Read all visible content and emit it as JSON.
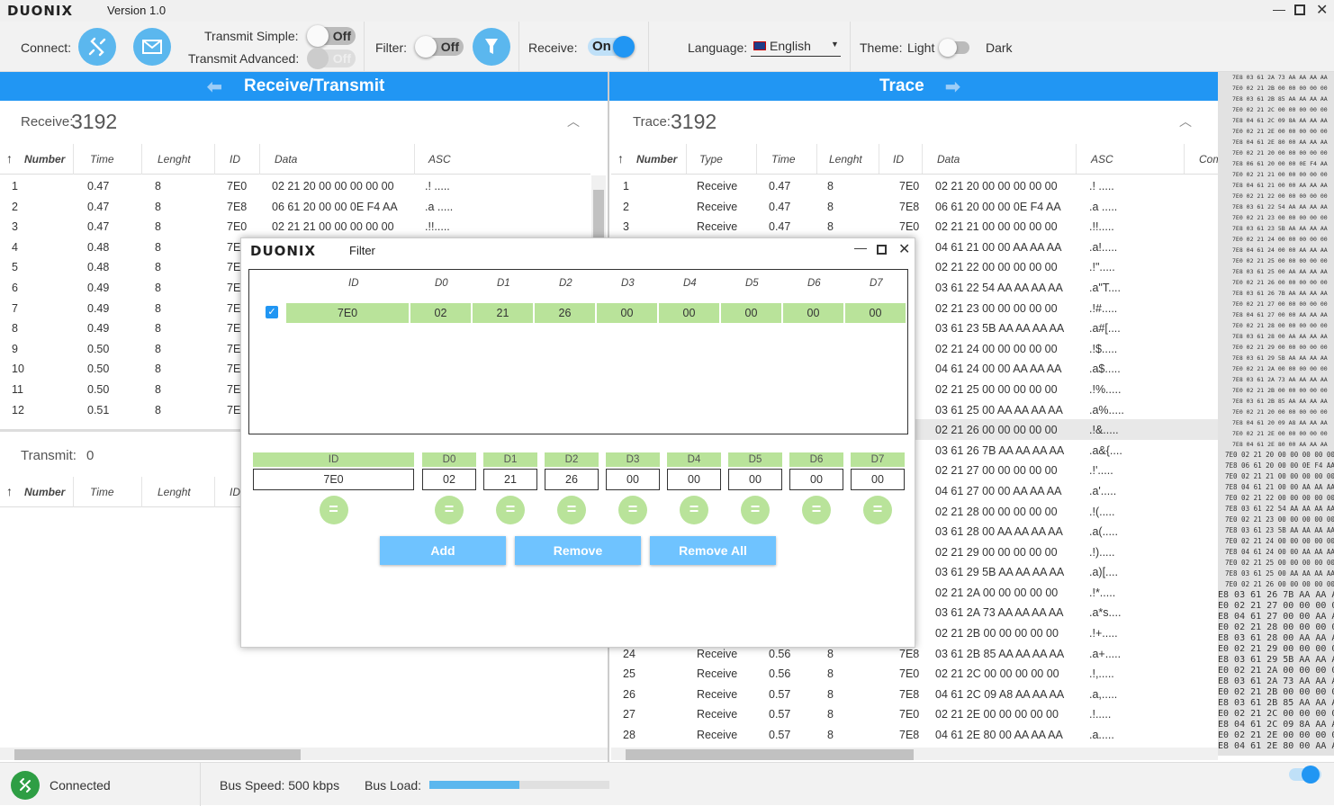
{
  "app": {
    "brand": "DUONIX",
    "version": "Version 1.0"
  },
  "toolbar": {
    "connect_label": "Connect:",
    "transmit_simple_label": "Transmit Simple:",
    "transmit_simple_state": "Off",
    "transmit_advanced_label": "Transmit Advanced:",
    "transmit_advanced_state": "Off",
    "filter_label": "Filter:",
    "filter_state": "Off",
    "receive_label": "Receive:",
    "receive_state": "On",
    "language_label": "Language:",
    "language_value": "English",
    "theme_label": "Theme:",
    "theme_light": "Light",
    "theme_dark": "Dark"
  },
  "left": {
    "title": "Receive/Transmit",
    "receive_label": "Receive:",
    "receive_count": "3192",
    "transmit_label": "Transmit:",
    "transmit_count": "0",
    "columns": [
      "Number",
      "Time",
      "Lenght",
      "ID",
      "Data",
      "ASC"
    ],
    "transmit_columns": [
      "Number",
      "Time",
      "Lenght",
      "ID"
    ],
    "rows": [
      [
        "1",
        "0.47",
        "8",
        "7E0",
        "02 21 20 00 00 00 00 00",
        ".! ....."
      ],
      [
        "2",
        "0.47",
        "8",
        "7E8",
        "06 61 20 00 00 0E F4 AA",
        ".a ....."
      ],
      [
        "3",
        "0.47",
        "8",
        "7E0",
        "02 21 21 00 00 00 00 00",
        ".!!....."
      ],
      [
        "4",
        "0.48",
        "8",
        "7E",
        "",
        ""
      ],
      [
        "5",
        "0.48",
        "8",
        "7E",
        "",
        ""
      ],
      [
        "6",
        "0.49",
        "8",
        "7E",
        "",
        ""
      ],
      [
        "7",
        "0.49",
        "8",
        "7E",
        "",
        ""
      ],
      [
        "8",
        "0.49",
        "8",
        "7E",
        "",
        ""
      ],
      [
        "9",
        "0.50",
        "8",
        "7E",
        "",
        ""
      ],
      [
        "10",
        "0.50",
        "8",
        "7E",
        "",
        ""
      ],
      [
        "11",
        "0.50",
        "8",
        "7E",
        "",
        ""
      ],
      [
        "12",
        "0.51",
        "8",
        "7E",
        "",
        ""
      ]
    ]
  },
  "right": {
    "title": "Trace",
    "trace_label": "Trace:",
    "trace_count": "3192",
    "columns": [
      "Number",
      "Type",
      "Time",
      "Lenght",
      "ID",
      "Data",
      "ASC",
      "Com"
    ],
    "rows": [
      [
        "1",
        "Receive",
        "0.47",
        "8",
        "7E0",
        "02 21 20 00 00 00 00 00",
        ".! ....."
      ],
      [
        "2",
        "Receive",
        "0.47",
        "8",
        "7E8",
        "06 61 20 00 00 0E F4 AA",
        ".a ....."
      ],
      [
        "3",
        "Receive",
        "0.47",
        "8",
        "7E0",
        "02 21 21 00 00 00 00 00",
        ".!!....."
      ],
      [
        "",
        "",
        "",
        "",
        "",
        "04 61 21 00 00 AA AA AA",
        ".a!....."
      ],
      [
        "",
        "",
        "",
        "",
        "",
        "02 21 22 00 00 00 00 00",
        ".!\"....."
      ],
      [
        "",
        "",
        "",
        "",
        "",
        "03 61 22 54 AA AA AA AA",
        ".a\"T...."
      ],
      [
        "",
        "",
        "",
        "",
        "",
        "02 21 23 00 00 00 00 00",
        ".!#....."
      ],
      [
        "",
        "",
        "",
        "",
        "",
        "03 61 23 5B AA AA AA AA",
        ".a#[...."
      ],
      [
        "",
        "",
        "",
        "",
        "",
        "02 21 24 00 00 00 00 00",
        ".!$....."
      ],
      [
        "",
        "",
        "",
        "",
        "",
        "04 61 24 00 00 AA AA AA",
        ".a$....."
      ],
      [
        "",
        "",
        "",
        "",
        "",
        "02 21 25 00 00 00 00 00",
        ".!%....."
      ],
      [
        "",
        "",
        "",
        "",
        "",
        "03 61 25 00 AA AA AA AA",
        ".a%....."
      ],
      [
        "",
        "",
        "",
        "",
        "",
        "02 21 26 00 00 00 00 00",
        ".!&....."
      ],
      [
        "",
        "",
        "",
        "",
        "",
        "03 61 26 7B AA AA AA AA",
        ".a&{...."
      ],
      [
        "",
        "",
        "",
        "",
        "",
        "02 21 27 00 00 00 00 00",
        ".!'....."
      ],
      [
        "",
        "",
        "",
        "",
        "",
        "04 61 27 00 00 AA AA AA",
        ".a'....."
      ],
      [
        "",
        "",
        "",
        "",
        "",
        "02 21 28 00 00 00 00 00",
        ".!(....."
      ],
      [
        "",
        "",
        "",
        "",
        "",
        "03 61 28 00 AA AA AA AA",
        ".a(....."
      ],
      [
        "",
        "",
        "",
        "",
        "",
        "02 21 29 00 00 00 00 00",
        ".!)....."
      ],
      [
        "",
        "",
        "",
        "",
        "",
        "03 61 29 5B AA AA AA AA",
        ".a)[...."
      ],
      [
        "",
        "",
        "",
        "",
        "",
        "02 21 2A 00 00 00 00 00",
        ".!*....."
      ],
      [
        "",
        "",
        "",
        "",
        "",
        "03 61 2A 73 AA AA AA AA",
        ".a*s...."
      ],
      [
        "",
        "",
        "",
        "",
        "",
        "02 21 2B 00 00 00 00 00",
        ".!+....."
      ],
      [
        "24",
        "Receive",
        "0.56",
        "8",
        "7E8",
        "03 61 2B 85 AA AA AA AA",
        ".a+....."
      ],
      [
        "25",
        "Receive",
        "0.56",
        "8",
        "7E0",
        "02 21 2C 00 00 00 00 00",
        ".!,....."
      ],
      [
        "26",
        "Receive",
        "0.57",
        "8",
        "7E8",
        "04 61 2C 09 A8 AA AA AA",
        ".a,....."
      ],
      [
        "27",
        "Receive",
        "0.57",
        "8",
        "7E0",
        "02 21 2E 00 00 00 00 00",
        ".!....."
      ],
      [
        "28",
        "Receive",
        "0.57",
        "8",
        "7E8",
        "04 61 2E 80 00 AA AA AA",
        ".a....."
      ]
    ]
  },
  "filter": {
    "title": "Filter",
    "brand": "DUONIX",
    "columns": [
      "ID",
      "D0",
      "D1",
      "D2",
      "D3",
      "D4",
      "D5",
      "D6",
      "D7"
    ],
    "entry": [
      "7E0",
      "02",
      "21",
      "26",
      "00",
      "00",
      "00",
      "00",
      "00"
    ],
    "inputs": [
      "7E0",
      "02",
      "21",
      "26",
      "00",
      "00",
      "00",
      "00",
      "00"
    ],
    "eq_symbol": "=",
    "add_label": "Add",
    "remove_label": "Remove",
    "remove_all_label": "Remove All"
  },
  "minilog": {
    "small": [
      "7E8 03 61 2A 73 AA AA AA AA",
      "7E0 02 21 2B 00 00 00 00 00",
      "7E8 03 61 2B 85 AA AA AA AA",
      "7E0 02 21 2C 00 00 00 00 00",
      "7E8 04 61 2C 09 8A AA AA AA",
      "7E0 02 21 2E 00 00 00 00 00",
      "7E8 04 61 2E 80 00 AA AA AA",
      "7E0 02 21 20 00 00 00 00 00",
      "7E8 06 61 20 00 00 0E F4 AA",
      "7E0 02 21 21 00 00 00 00 00",
      "7E8 04 61 21 00 00 AA AA AA",
      "7E0 02 21 22 00 00 00 00 00",
      "7E8 03 61 22 54 AA AA AA AA",
      "7E0 02 21 23 00 00 00 00 00",
      "7E8 03 61 23 5B AA AA AA AA",
      "7E0 02 21 24 00 00 00 00 00",
      "7E8 04 61 24 00 00 AA AA AA",
      "7E0 02 21 25 00 00 00 00 00",
      "7E8 03 61 25 00 AA AA AA AA",
      "7E0 02 21 26 00 00 00 00 00",
      "7E8 03 61 26 7B AA AA AA AA",
      "7E0 02 21 27 00 00 00 00 00",
      "7E8 04 61 27 00 00 AA AA AA",
      "7E0 02 21 28 00 00 00 00 00",
      "7E8 03 61 28 00 AA AA AA AA",
      "7E0 02 21 29 00 00 00 00 00",
      "7E8 03 61 29 5B AA AA AA AA",
      "7E0 02 21 2A 00 00 00 00 00",
      "7E8 03 61 2A 73 AA AA AA AA",
      "7E0 02 21 2B 00 00 00 00 00",
      "7E8 03 61 2B 85 AA AA AA AA",
      "7E0 02 21 20 00 00 00 00 00",
      "7E8 04 61 20 09 A8 AA AA AA",
      "7E0 02 21 2E 00 00 00 00 00",
      "7E8 04 61 2E 80 00 AA AA AA"
    ],
    "mid": [
      "7E0 02 21 20 00 00 00 00 00",
      "7E8 06 61 20 00 00 0E F4 AA",
      "7E0 02 21 21 00 00 00 00 00",
      "7E8 04 61 21 00 00 AA AA AA",
      "7E0 02 21 22 00 00 00 00 00",
      "7E8 03 61 22 54 AA AA AA AA",
      "7E0 02 21 23 00 00 00 00 00",
      "7E8 03 61 23 5B AA AA AA AA",
      "7E0 02 21 24 00 00 00 00 00",
      "7E8 04 61 24 00 00 AA AA AA",
      "7E0 02 21 25 00 00 00 00 00",
      "7E8 03 61 25 00 AA AA AA AA",
      "7E0 02 21 26 00 00 00 00 00"
    ],
    "big": [
      "E8 03 61 26 7B AA AA AA A",
      "E0 02 21 27 00 00 00 00 0",
      "E8 04 61 27 00 00 AA AA A",
      "E0 02 21 28 00 00 00 00 0",
      "E8 03 61 28 00 AA AA AA A",
      "E0 02 21 29 00 00 00 00 0",
      "E8 03 61 29 5B AA AA AA A",
      "E0 02 21 2A 00 00 00 00 0",
      "E8 03 61 2A 73 AA AA AA A",
      "E0 02 21 2B 00 00 00 00 0",
      "E8 03 61 2B 85 AA AA AA A",
      "E0 02 21 2C 00 00 00 00 0",
      "E8 04 61 2C 09 8A AA AA A",
      "E0 02 21 2E 00 00 00 00 0",
      "E8 04 61 2E 80 00 AA AA A"
    ]
  },
  "status": {
    "connected": "Connected",
    "bus_speed": "Bus Speed: 500 kbps",
    "bus_load_label": "Bus Load:",
    "bus_load_fraction": 0.5
  }
}
